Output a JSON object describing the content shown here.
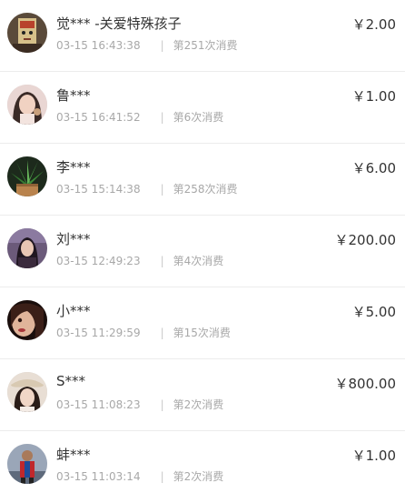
{
  "records": [
    {
      "name": "觉*** -关爱特殊孩子",
      "time": "03-15 16:43:38",
      "count": "第251次消费",
      "amount": "￥2.00",
      "avatar_icon": "user-avatar-icon"
    },
    {
      "name": "鲁***",
      "time": "03-15 16:41:52",
      "count": "第6次消费",
      "amount": "￥1.00",
      "avatar_icon": "user-avatar-icon"
    },
    {
      "name": "李***",
      "time": "03-15 15:14:38",
      "count": "第258次消费",
      "amount": "￥6.00",
      "avatar_icon": "plant-avatar-icon"
    },
    {
      "name": "刘***",
      "time": "03-15 12:49:23",
      "count": "第4次消费",
      "amount": "￥200.00",
      "avatar_icon": "user-avatar-icon"
    },
    {
      "name": "小***",
      "time": "03-15 11:29:59",
      "count": "第15次消费",
      "amount": "￥5.00",
      "avatar_icon": "user-avatar-icon"
    },
    {
      "name": "S***",
      "time": "03-15 11:08:23",
      "count": "第2次消费",
      "amount": "￥800.00",
      "avatar_icon": "user-avatar-icon"
    },
    {
      "name": "蚌***",
      "time": "03-15 11:03:14",
      "count": "第2次消费",
      "amount": "￥1.00",
      "avatar_icon": "user-avatar-icon"
    }
  ],
  "separator": "|"
}
